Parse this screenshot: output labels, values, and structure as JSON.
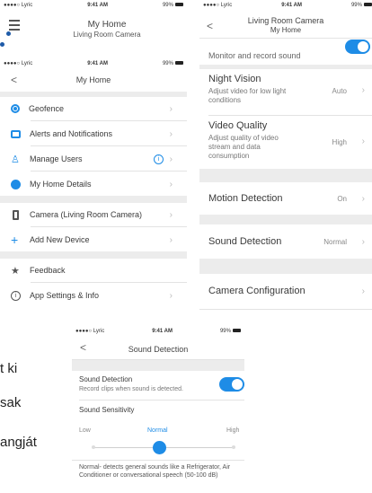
{
  "bg_cropped_texts": [
    "t ki",
    "sak",
    "angját"
  ],
  "top_left": {
    "status": {
      "carrier": "●●●●○ Lyric",
      "wifi": "ᯐ",
      "time": "9:41 AM",
      "battery": "99%"
    },
    "title": "My Home",
    "subtitle": "Living Room Camera"
  },
  "menu": {
    "status": {
      "carrier": "●●●●○ Lyric",
      "time": "9:41 AM",
      "battery": "99%"
    },
    "back": "<",
    "title": "My Home",
    "items": [
      {
        "label": "Geofence",
        "icon": "geofence-icon"
      },
      {
        "label": "Alerts and Notifications",
        "icon": "chat-icon"
      },
      {
        "label": "Manage Users",
        "icon": "users-icon",
        "info": "i"
      },
      {
        "label": "My Home Details",
        "icon": "globe-icon"
      },
      {
        "label": "Camera (Living Room Camera)",
        "icon": "phone-device-icon"
      },
      {
        "label": "Add New Device",
        "icon": "plus-icon"
      },
      {
        "label": "Feedback",
        "icon": "star-icon"
      },
      {
        "label": "App Settings & Info",
        "icon": "info-icon"
      }
    ]
  },
  "camera": {
    "status": {
      "carrier": "●●●●○ Lyric",
      "time": "9:41 AM",
      "battery": "99%"
    },
    "back": "<",
    "title": "Living Room Camera",
    "subtitle": "My Home",
    "monitor": "Monitor and record sound",
    "night_vision": {
      "label": "Night Vision",
      "desc": "Adjust video for low light conditions",
      "value": "Auto"
    },
    "video_quality": {
      "label": "Video Quality",
      "desc": "Adjust quality of video stream and data consumption",
      "value": "High"
    },
    "motion": {
      "label": "Motion Detection",
      "value": "On"
    },
    "sound": {
      "label": "Sound Detection",
      "value": "Normal"
    },
    "config": {
      "label": "Camera Configuration"
    }
  },
  "sound_detection": {
    "status": {
      "carrier": "●●●●○ Lyric",
      "time": "9:41 AM",
      "battery": "99%"
    },
    "back": "<",
    "title": "Sound Detection",
    "toggle_label": "Sound Detection",
    "toggle_desc": "Record clips when sound is detected.",
    "sensitivity_label": "Sound Sensitivity",
    "levels": [
      "Low",
      "Normal",
      "High"
    ],
    "description": "Normal- detects general sounds like a Refrigerator, Air Conditioner or conversational speech (50-100 dB)"
  },
  "colors": {
    "accent": "#1e8ce6"
  }
}
